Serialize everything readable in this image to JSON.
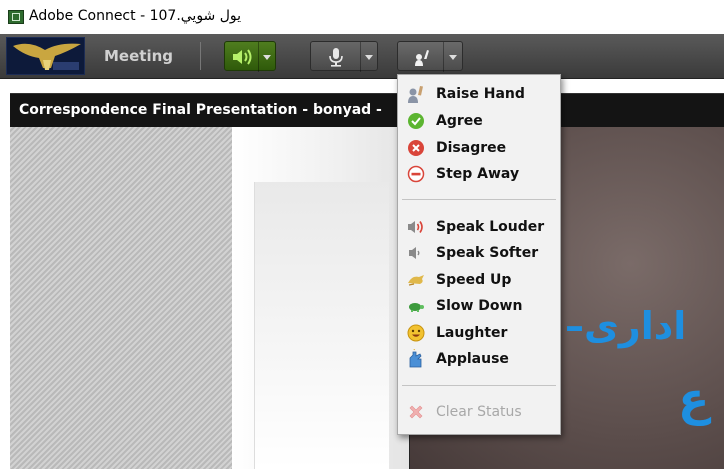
{
  "window": {
    "title": "Adobe Connect - يول شويي.107"
  },
  "toolbar": {
    "meeting_label": "Meeting",
    "speaker_button": {
      "icon": "speaker-icon",
      "active": true
    },
    "mic_button": {
      "icon": "microphone-icon"
    },
    "status_button": {
      "icon": "raise-hand-icon"
    }
  },
  "pod": {
    "title": "Correspondence Final Presentation - bonyad -"
  },
  "slide": {
    "text_line1": "اداری–",
    "text_line2": "ع"
  },
  "status_menu": {
    "group1": [
      {
        "label": "Raise Hand",
        "icon": "raise-hand-icon"
      },
      {
        "label": "Agree",
        "icon": "agree-check-icon"
      },
      {
        "label": "Disagree",
        "icon": "disagree-x-icon"
      },
      {
        "label": "Step Away",
        "icon": "step-away-icon"
      }
    ],
    "group2": [
      {
        "label": "Speak Louder",
        "icon": "speak-louder-icon"
      },
      {
        "label": "Speak Softer",
        "icon": "speak-softer-icon"
      },
      {
        "label": "Speed Up",
        "icon": "speed-up-icon"
      },
      {
        "label": "Slow Down",
        "icon": "slow-down-icon"
      },
      {
        "label": "Laughter",
        "icon": "laughter-icon"
      },
      {
        "label": "Applause",
        "icon": "applause-icon"
      }
    ],
    "clear_status": {
      "label": "Clear Status",
      "icon": "clear-status-icon",
      "enabled": false
    }
  },
  "colors": {
    "speaker_active": "#3f6d14",
    "agree": "#5cb531",
    "disagree": "#d9453a",
    "slide_text": "#1e8fe0"
  }
}
